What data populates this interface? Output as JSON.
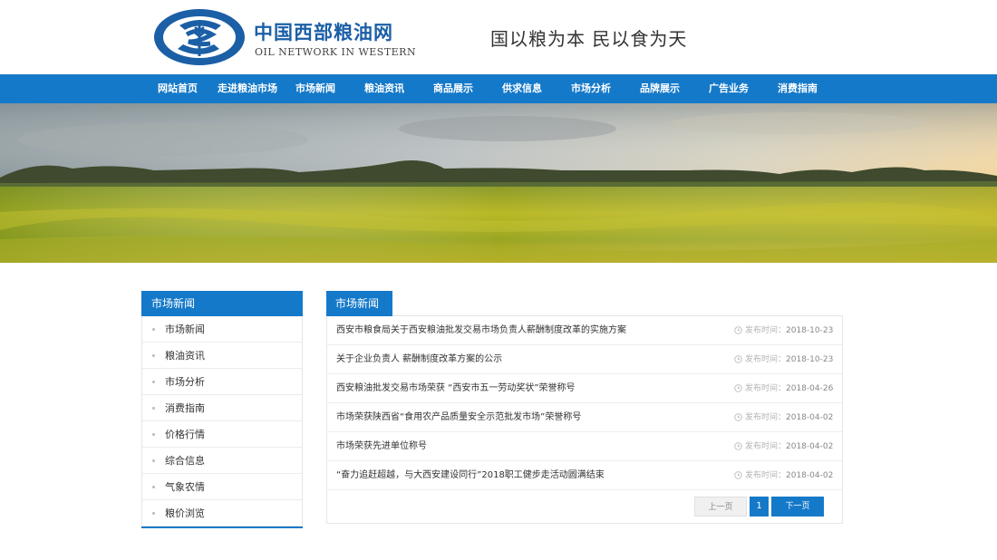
{
  "header": {
    "logo_cn": "中国西部粮油网",
    "logo_en": "OIL NETWORK IN WESTERN",
    "slogan": "国以粮为本 民以食为天"
  },
  "nav": {
    "items": [
      {
        "label": "网站首页"
      },
      {
        "label": "走进粮油市场"
      },
      {
        "label": "市场新闻"
      },
      {
        "label": "粮油资讯"
      },
      {
        "label": "商品展示"
      },
      {
        "label": "供求信息"
      },
      {
        "label": "市场分析"
      },
      {
        "label": "品牌展示"
      },
      {
        "label": "广告业务"
      },
      {
        "label": "消费指南"
      }
    ]
  },
  "sidebar": {
    "title": "市场新闻",
    "items": [
      {
        "label": "市场新闻"
      },
      {
        "label": "粮油资讯"
      },
      {
        "label": "市场分析"
      },
      {
        "label": "消费指南"
      },
      {
        "label": "价格行情"
      },
      {
        "label": "综合信息"
      },
      {
        "label": "气象农情"
      },
      {
        "label": "粮价浏览"
      }
    ]
  },
  "main": {
    "title": "市场新闻",
    "date_label": "发布时间：",
    "news": [
      {
        "title": "西安市粮食局关于西安粮油批发交易市场负责人薪酬制度改革的实施方案",
        "date": "2018-10-23"
      },
      {
        "title": "关于企业负责人 薪酬制度改革方案的公示",
        "date": "2018-10-23"
      },
      {
        "title": "西安粮油批发交易市场荣获 “西安市五一劳动奖状”荣誉称号",
        "date": "2018-04-26"
      },
      {
        "title": "市场荣获陕西省“食用农产品质量安全示范批发市场”荣誉称号",
        "date": "2018-04-02"
      },
      {
        "title": "市场荣获先进单位称号",
        "date": "2018-04-02"
      },
      {
        "title": "“奋力追赶超越，与大西安建设同行”2018职工健步走活动圆满结束",
        "date": "2018-04-02"
      }
    ],
    "pager": {
      "prev": "上一页",
      "current": "1",
      "next": "下一页"
    }
  },
  "colors": {
    "brand_blue": "#1579c9",
    "logo_blue": "#1b5fa6"
  },
  "icons": {
    "logo": "wheat-emblem-icon",
    "date": "clock-icon"
  }
}
